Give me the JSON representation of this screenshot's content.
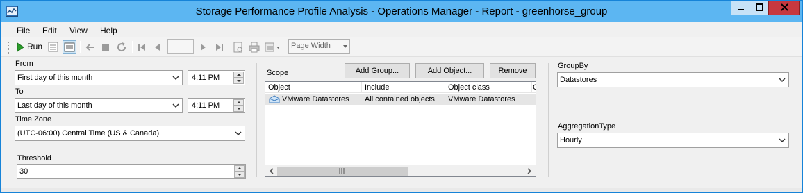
{
  "window": {
    "title": "Storage Performance Profile Analysis - Operations Manager - Report - greenhorse_group",
    "icon": "report-window-icon",
    "controls": [
      "minimize-icon",
      "maximize-icon",
      "close-icon"
    ]
  },
  "menu": {
    "file": "File",
    "edit": "Edit",
    "view": "View",
    "help": "Help"
  },
  "toolbar": {
    "run_label": "Run",
    "page_number": "",
    "zoom": "Page Width",
    "icons": [
      "run-icon",
      "parameters-icon",
      "document-map-icon",
      "back-icon",
      "stop-icon",
      "refresh-icon",
      "first-page-icon",
      "previous-page-icon",
      "next-page-icon",
      "last-page-icon",
      "page-setup-icon",
      "print-icon",
      "export-icon"
    ]
  },
  "params": {
    "from_label": "From",
    "from_value": "First day of this month",
    "from_time": "4:11 PM",
    "to_label": "To",
    "to_value": "Last day of this month",
    "to_time": "4:11 PM",
    "timezone_label": "Time Zone",
    "timezone_value": "(UTC-06:00) Central Time (US & Canada)",
    "threshold_label": "Threshold",
    "threshold_value": "30"
  },
  "scope": {
    "label": "Scope",
    "add_group": "Add Group...",
    "add_object": "Add Object...",
    "remove": "Remove",
    "columns": [
      "Object",
      "Include",
      "Object class",
      "C"
    ],
    "rows": [
      {
        "object": "VMware Datastores",
        "include": "All contained objects",
        "object_class": "VMware Datastores"
      }
    ]
  },
  "grouping": {
    "groupby_label": "GroupBy",
    "groupby_value": "Datastores",
    "aggregation_label": "AggregationType",
    "aggregation_value": "Hourly"
  },
  "colors": {
    "titlebar": "#5cb6f2",
    "window_border": "#1683d8",
    "close_button": "#c7383f",
    "row_highlight": "#e5e5e5"
  }
}
